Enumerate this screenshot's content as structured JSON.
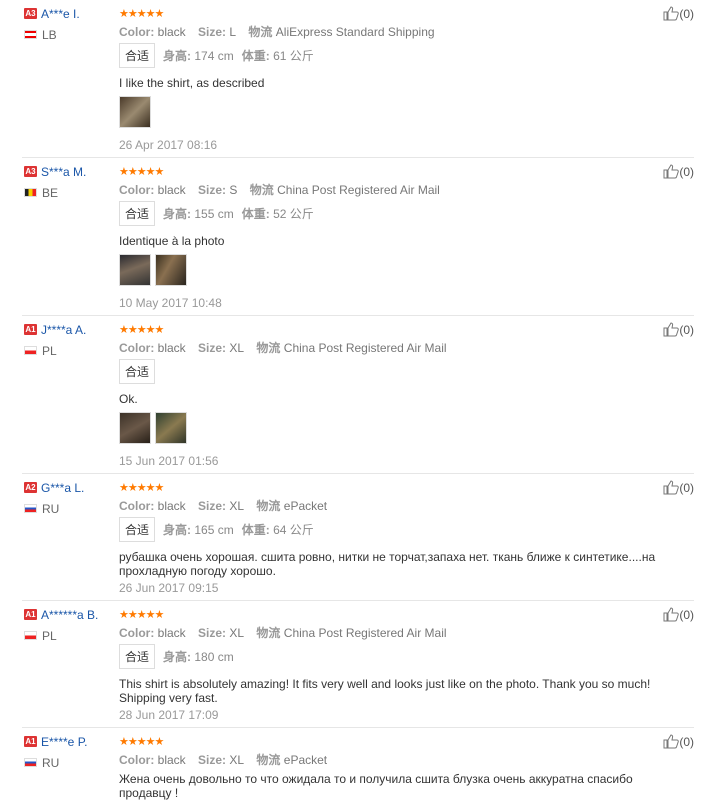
{
  "reviews": [
    {
      "level": "A3",
      "name": "A***e I.",
      "country": "LB",
      "flag_colors": [
        "#e00",
        "#fff",
        "#e00"
      ],
      "stars": "★★★★★",
      "color_label": "Color:",
      "color": "black",
      "size_label": "Size:",
      "size": "L",
      "ship_label": "物流",
      "ship": "AliExpress Standard Shipping",
      "chip": "合适",
      "height_label": "身高:",
      "height": "174 cm",
      "weight_label": "体重:",
      "weight": "61 公斤",
      "text": "I like the shirt, as described",
      "photos": 1,
      "date": "26 Apr 2017 08:16",
      "helpful": "(0)"
    },
    {
      "level": "A3",
      "name": "S***a M.",
      "country": "BE",
      "flag_colors": [
        "#222",
        "#f5d200",
        "#e22"
      ],
      "stars": "★★★★★",
      "color_label": "Color:",
      "color": "black",
      "size_label": "Size:",
      "size": "S",
      "ship_label": "物流",
      "ship": "China Post Registered Air Mail",
      "chip": "合适",
      "height_label": "身高:",
      "height": "155 cm",
      "weight_label": "体重:",
      "weight": "52 公斤",
      "text": "Identique à la photo",
      "photos": 2,
      "date": "10 May 2017 10:48",
      "helpful": "(0)"
    },
    {
      "level": "A1",
      "name": "J****a A.",
      "country": "PL",
      "flag_colors": [
        "#fff",
        "#e22"
      ],
      "stars": "★★★★★",
      "color_label": "Color:",
      "color": "black",
      "size_label": "Size:",
      "size": "XL",
      "ship_label": "物流",
      "ship": "China Post Registered Air Mail",
      "chip": "合适",
      "height_label": "",
      "height": "",
      "weight_label": "",
      "weight": "",
      "text": "Ok.",
      "photos": 2,
      "date": "15 Jun 2017 01:56",
      "helpful": "(0)"
    },
    {
      "level": "A2",
      "name": "G***a L.",
      "country": "RU",
      "flag_colors": [
        "#fff",
        "#2456c8",
        "#e22"
      ],
      "stars": "★★★★★",
      "color_label": "Color:",
      "color": "black",
      "size_label": "Size:",
      "size": "XL",
      "ship_label": "物流",
      "ship": "ePacket",
      "chip": "合适",
      "height_label": "身高:",
      "height": "165 cm",
      "weight_label": "体重:",
      "weight": "64 公斤",
      "text": "рубашка очень хорошая. сшита ровно, нитки не торчат,запаха нет. ткань ближе к синтетике....на прохладную погоду хорошо.",
      "photos": 0,
      "date": "26 Jun 2017 09:15",
      "helpful": "(0)"
    },
    {
      "level": "A1",
      "name": "A******a B.",
      "country": "PL",
      "flag_colors": [
        "#fff",
        "#e22"
      ],
      "stars": "★★★★★",
      "color_label": "Color:",
      "color": "black",
      "size_label": "Size:",
      "size": "XL",
      "ship_label": "物流",
      "ship": "China Post Registered Air Mail",
      "chip": "合适",
      "height_label": "身高:",
      "height": "180 cm",
      "weight_label": "",
      "weight": "",
      "text": "This shirt is absolutely amazing! It fits very well and looks just like on the photo. Thank you so much! Shipping very fast.",
      "photos": 0,
      "date": "28 Jun 2017 17:09",
      "helpful": "(0)"
    },
    {
      "level": "A1",
      "name": "E****e P.",
      "country": "RU",
      "flag_colors": [
        "#fff",
        "#2456c8",
        "#e22"
      ],
      "stars": "★★★★★",
      "color_label": "Color:",
      "color": "black",
      "size_label": "Size:",
      "size": "XL",
      "ship_label": "物流",
      "ship": "ePacket",
      "chip": "",
      "height_label": "",
      "height": "",
      "weight_label": "",
      "weight": "",
      "text": "Жена очень довольно то что ожидала то и получила сшита блузка очень аккуратна спасибо продавцу !",
      "photos": 0,
      "date": "",
      "helpful": "(0)"
    }
  ],
  "icons": {
    "helpful": "thumbs-up-icon",
    "rating": "star-icon"
  }
}
